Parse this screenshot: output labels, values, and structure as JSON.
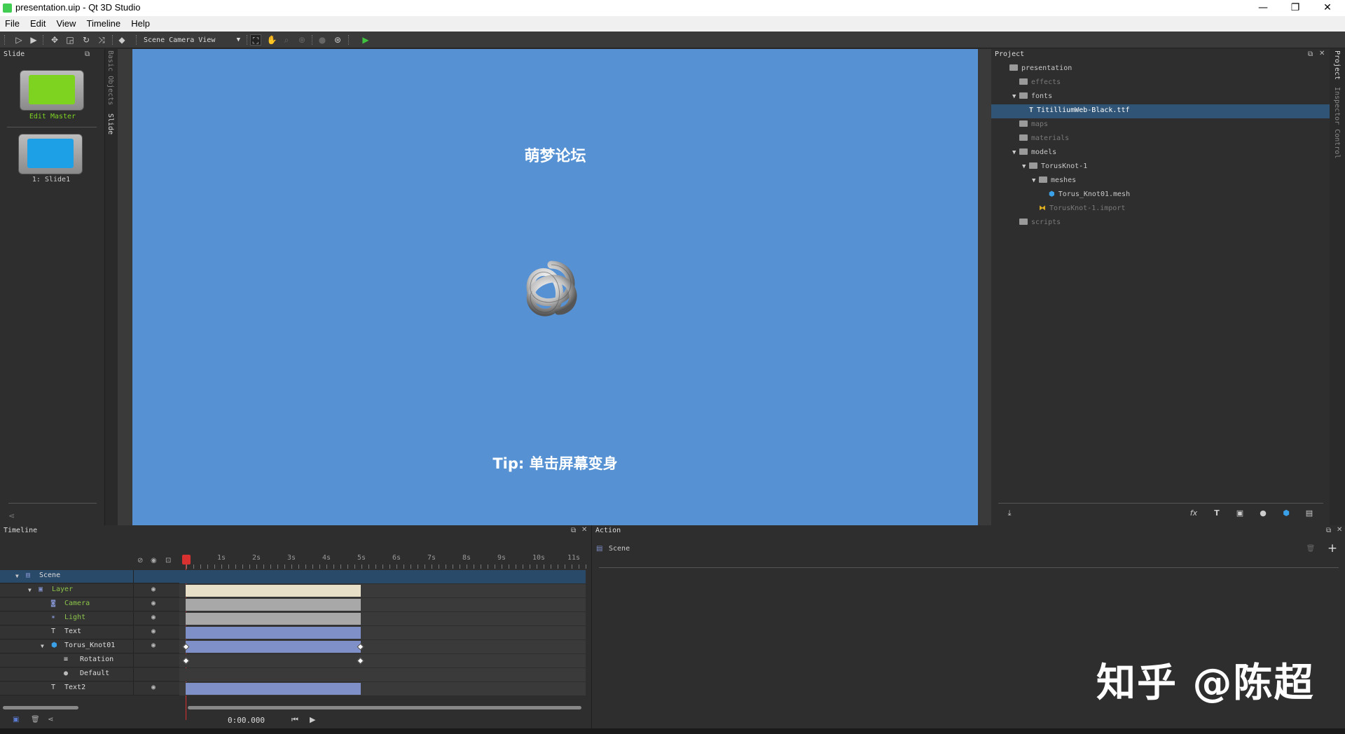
{
  "window": {
    "title": "presentation.uip - Qt 3D Studio",
    "controls": [
      "—",
      "❐",
      "✕"
    ]
  },
  "menu": {
    "file": "File",
    "edit": "Edit",
    "view": "View",
    "timeline": "Timeline",
    "help": "Help"
  },
  "toolbar": {
    "camera_view": "Scene Camera View"
  },
  "slide_panel": {
    "title": "Slide",
    "master_label": "Edit Master",
    "slide1_label": "1: Slide1",
    "vtab_basic": "Basic Objects",
    "vtab_slide": "Slide",
    "master_color": "#7ed321",
    "slide_color": "#1ea0e6"
  },
  "scene": {
    "title": "萌梦论坛",
    "tip_bold": "Tip:",
    "tip_text": " 单击屏幕变身",
    "background": "#5691d3"
  },
  "project": {
    "title": "Project",
    "vtab_project": "Project",
    "vtab_inspector": "Inspector Control",
    "tree": [
      {
        "label": "presentation",
        "level": 0,
        "arrow": "",
        "icon": "folder",
        "dim": false
      },
      {
        "label": "effects",
        "level": 1,
        "arrow": "",
        "icon": "folder",
        "dim": true
      },
      {
        "label": "fonts",
        "level": 1,
        "arrow": "▼",
        "icon": "folder",
        "dim": false
      },
      {
        "label": "TitilliumWeb-Black.ttf",
        "level": 2,
        "arrow": "",
        "icon": "T",
        "dim": false,
        "selected": true
      },
      {
        "label": "maps",
        "level": 1,
        "arrow": "",
        "icon": "folder",
        "dim": true
      },
      {
        "label": "materials",
        "level": 1,
        "arrow": "",
        "icon": "folder",
        "dim": true
      },
      {
        "label": "models",
        "level": 1,
        "arrow": "▼",
        "icon": "folder",
        "dim": false
      },
      {
        "label": "TorusKnot-1",
        "level": 2,
        "arrow": "▼",
        "icon": "folder",
        "dim": false
      },
      {
        "label": "meshes",
        "level": 3,
        "arrow": "▼",
        "icon": "folder",
        "dim": false
      },
      {
        "label": "Torus_Knot01.mesh",
        "level": 4,
        "arrow": "",
        "icon": "mesh",
        "dim": false
      },
      {
        "label": "TorusKnot-1.import",
        "level": 3,
        "arrow": "",
        "icon": "import",
        "dim": true
      },
      {
        "label": "scripts",
        "level": 1,
        "arrow": "",
        "icon": "folder",
        "dim": true
      }
    ]
  },
  "timeline": {
    "title": "Timeline",
    "time": "0:00.000",
    "ruler": [
      "1s",
      "2s",
      "3s",
      "4s",
      "5s",
      "6s",
      "7s",
      "8s",
      "9s",
      "10s",
      "11s"
    ],
    "rows": [
      {
        "name": "Scene",
        "indent": 0,
        "arrow": "▼",
        "icon": "scene",
        "color": "#ddd",
        "bar": "scene",
        "eye": false
      },
      {
        "name": "Layer",
        "indent": 1,
        "arrow": "▼",
        "icon": "layer",
        "color": "#8bc34a",
        "bar": "#e8dfc8",
        "eye": true
      },
      {
        "name": "Camera",
        "indent": 2,
        "arrow": "",
        "icon": "camera",
        "color": "#8bc34a",
        "bar": "#a8a8a8",
        "eye": true
      },
      {
        "name": "Light",
        "indent": 2,
        "arrow": "",
        "icon": "light",
        "color": "#8bc34a",
        "bar": "#a8a8a8",
        "eye": true
      },
      {
        "name": "Text",
        "indent": 2,
        "arrow": "",
        "icon": "text",
        "color": "#ddd",
        "bar": "#7f8fc8",
        "eye": true
      },
      {
        "name": "Torus_Knot01",
        "indent": 2,
        "arrow": "▼",
        "icon": "model",
        "color": "#ddd",
        "bar": "#7f8fc8",
        "eye": true
      },
      {
        "name": "Rotation",
        "indent": 3,
        "arrow": "",
        "icon": "prop",
        "color": "#ddd",
        "bar": "keys",
        "eye": false
      },
      {
        "name": "Default",
        "indent": 3,
        "arrow": "",
        "icon": "material",
        "color": "#ddd",
        "bar": "",
        "eye": false
      },
      {
        "name": "Text2",
        "indent": 2,
        "arrow": "",
        "icon": "text",
        "color": "#ddd",
        "bar": "#7f8fc8",
        "eye": true
      }
    ]
  },
  "action": {
    "title": "Action",
    "scene_label": "Scene",
    "add": "+"
  },
  "watermark": "知乎 @陈超"
}
